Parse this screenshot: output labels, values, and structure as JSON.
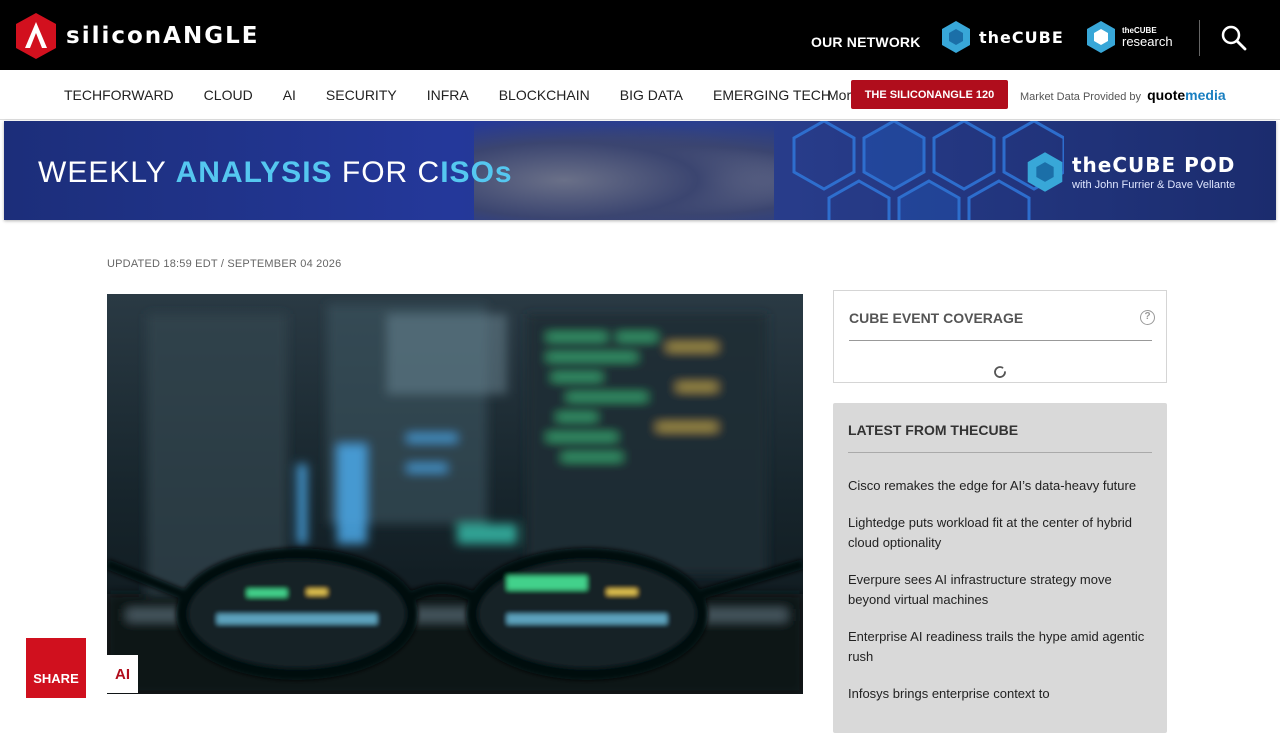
{
  "header": {
    "logo_text": "siliconANGLE",
    "our_network": "OUR NETWORK",
    "thecube": "theCUBE",
    "research_small": "theCUBE",
    "research_big": "research"
  },
  "nav": {
    "items": [
      "TECHFORWARD",
      "CLOUD",
      "AI",
      "SECURITY",
      "INFRA",
      "BLOCKCHAIN",
      "BIG DATA",
      "EMERGING TECH"
    ],
    "more": "More",
    "sa120": "THE SILICONANGLE 120",
    "market_label": "Market Data Provided by",
    "quote": "quote",
    "media": "media"
  },
  "banner": {
    "pre": "WEEKLY ",
    "accent": "ANALYSIS",
    "mid": " FOR C",
    "accent2": "ISOs",
    "pod_title": "theCUBE POD",
    "pod_sub": "with John Furrier & Dave Vellante"
  },
  "article": {
    "updated": "UPDATED 18:59 EDT / SEPTEMBER 04 2026",
    "tag": "AI",
    "share": "SHARE"
  },
  "sidebar": {
    "coverage_title": "CUBE EVENT COVERAGE",
    "help": "?",
    "latest_title": "LATEST FROM THECUBE",
    "latest_items": [
      "Cisco remakes the edge for AI’s data-heavy future",
      "Lightedge puts workload fit at the center of hybrid cloud optionality",
      "Everpure sees AI infrastructure strategy move beyond virtual machines",
      "Enterprise AI readiness trails the hype amid agentic rush",
      "Infosys brings enterprise context to"
    ]
  },
  "colors": {
    "brand_red": "#b00d1c",
    "share_red": "#d0101e",
    "banner_accent": "#55c7f0"
  }
}
